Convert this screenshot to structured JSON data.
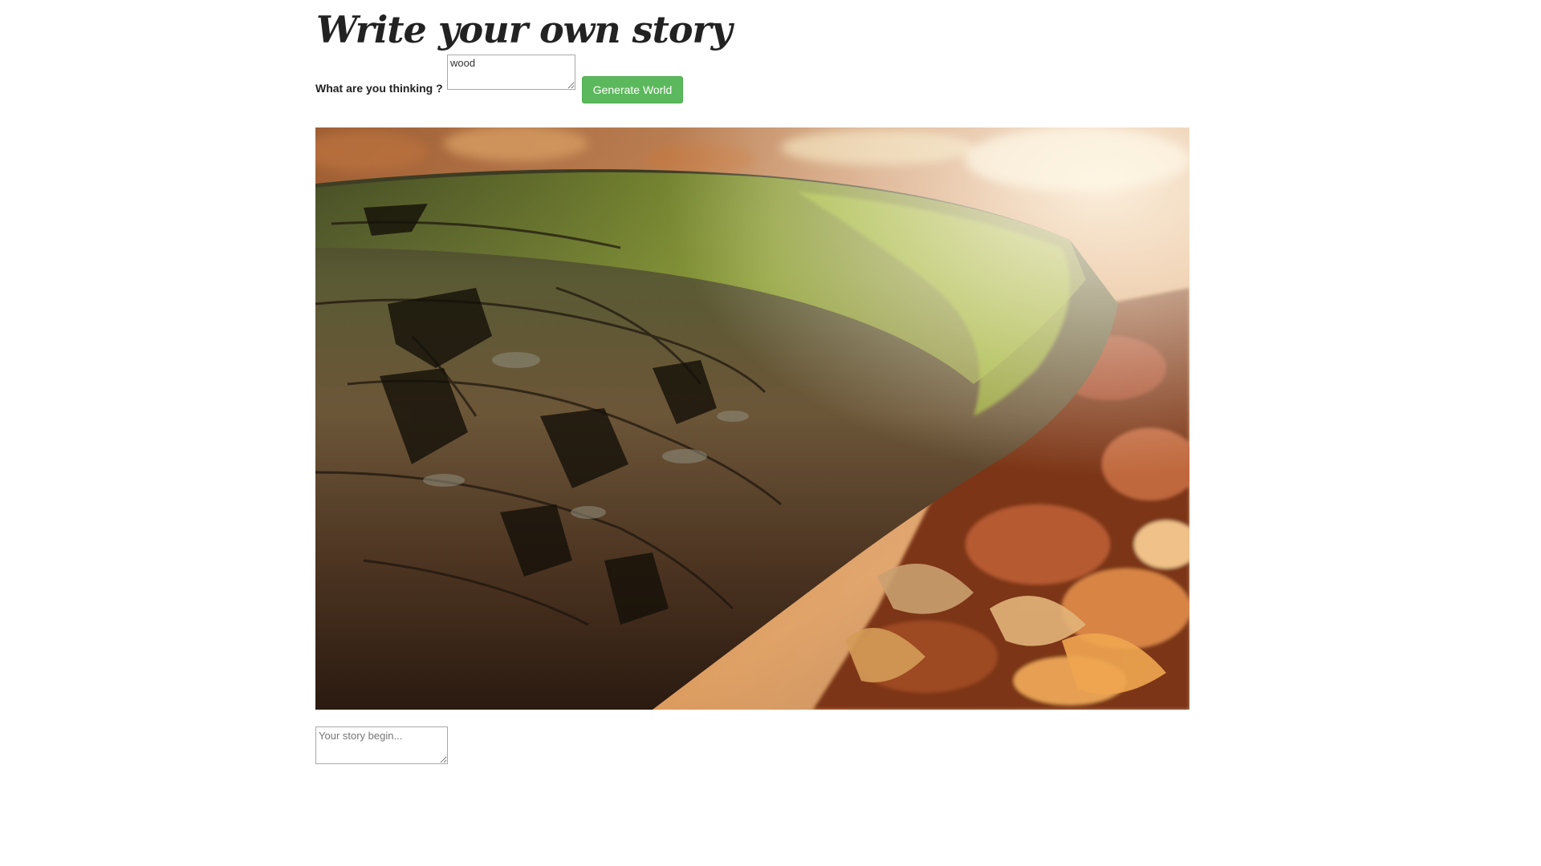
{
  "page": {
    "title": "Write your own story"
  },
  "prompt": {
    "label": "What are you thinking ?",
    "value": "wood"
  },
  "actions": {
    "generate_label": "Generate World"
  },
  "world_image": {
    "description_icon": "forest-log-photo"
  },
  "story": {
    "placeholder": "Your story begin...",
    "value": ""
  },
  "colors": {
    "button_bg": "#5cb85c",
    "button_border": "#4cae4c",
    "button_text": "#ffffff",
    "text": "#222222"
  }
}
